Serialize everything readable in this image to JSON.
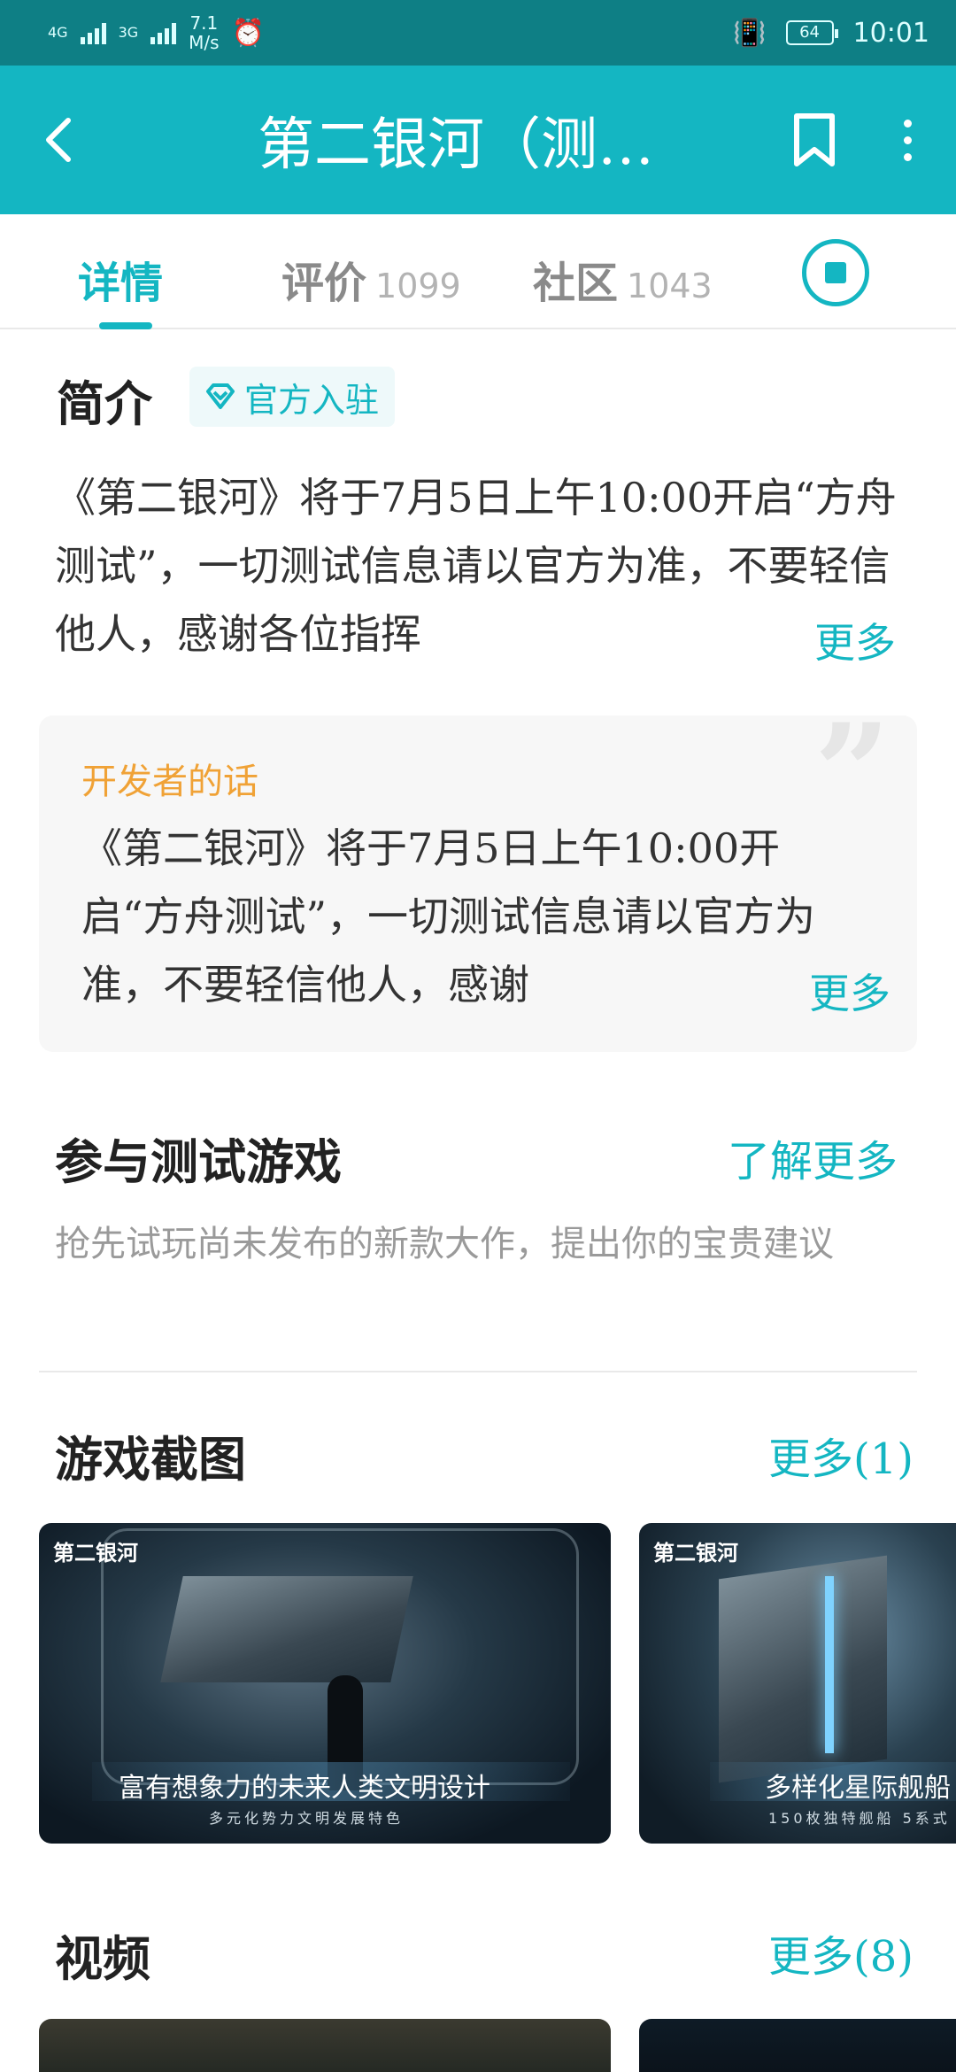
{
  "status_bar": {
    "network1": "4G",
    "network2": "3G",
    "speed_value": "7.1",
    "speed_unit": "M/s",
    "battery": "64",
    "time": "10:01"
  },
  "app_bar": {
    "title": "第二银河（测…",
    "back_icon": "back-arrow-icon",
    "bookmark_icon": "bookmark-icon",
    "more_icon": "more-vertical-icon"
  },
  "tabs": [
    {
      "label": "详情",
      "count": ""
    },
    {
      "label": "评价",
      "count": "1099"
    },
    {
      "label": "社区",
      "count": "1043"
    }
  ],
  "intro": {
    "title": "简介",
    "badge": "官方入驻",
    "text": "《第二银河》将于7月5日上午10:00开启“方舟测试”，一切测试信息请以官方为准，不要轻信他人，感谢各位指挥",
    "more": "更多"
  },
  "developer": {
    "title": "开发者的话",
    "text": "《第二银河》将于7月5日上午10:00开启“方舟测试”，一切测试信息请以官方为准，不要轻信他人，感谢",
    "more": "更多"
  },
  "test_section": {
    "title": "参与测试游戏",
    "link": "了解更多",
    "desc": "抢先试玩尚未发布的新款大作，提出你的宝贵建议"
  },
  "screenshots": {
    "title": "游戏截图",
    "more": "更多(1)",
    "items": [
      {
        "logo": "第二银河",
        "caption": "富有想象力的未来人类文明设计",
        "subcaption": "多元化势力文明发展特色"
      },
      {
        "logo": "第二银河",
        "caption": "多样化星际舰船",
        "subcaption": "150枚独特舰船 5系式"
      }
    ]
  },
  "videos": {
    "title": "视频",
    "more": "更多(8)"
  },
  "colors": {
    "accent": "#14b6c2",
    "status_bar": "#0e7f85",
    "developer_title": "#f0a236"
  }
}
